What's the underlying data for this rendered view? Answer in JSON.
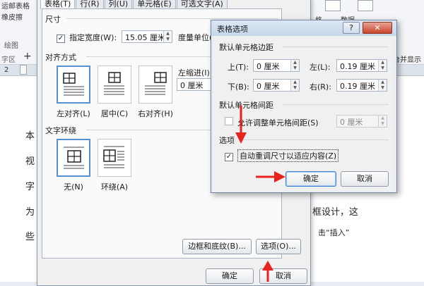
{
  "background": {
    "left_ribbon": [
      "运邮表格",
      "橡皮擦"
    ],
    "drawing_group": "绘图",
    "tab_zone": "字区",
    "plus": "+",
    "ruler_num": "2",
    "right_top": [
      "格",
      "数据"
    ],
    "merge_display": "台并显示",
    "doc_left_chars": [
      "本",
      "视",
      "字",
      "为",
      "些"
    ],
    "doc_right_line1": "框设计，这",
    "doc_right_line2": "击“插入”"
  },
  "table_props": {
    "tabs": [
      "表格(T)",
      "行(R)",
      "列(U)",
      "单元格(E)",
      "可选文字(A)"
    ],
    "size_section": "尺寸",
    "preferred_width_label": "指定宽度(W):",
    "preferred_width_checked": true,
    "preferred_width_value": "15.05 厘米",
    "measure_in_label": "度量单位(",
    "alignment_section": "对齐方式",
    "align_left": "左对齐(L)",
    "align_center": "居中(C)",
    "align_right": "右对齐(H)",
    "indent_label": "左缩进(I):",
    "indent_value": "0 厘米",
    "wrap_section": "文字环绕",
    "wrap_none": "无(N)",
    "wrap_around": "环绕(A)",
    "borders_button": "边框和底纹(B)...",
    "options_button": "选项(O)...",
    "ok_button": "确定",
    "cancel_button": "取消"
  },
  "table_options": {
    "title": "表格选项",
    "help": "?",
    "close": "✕",
    "margins_section": "默认单元格边距",
    "top_label": "上(T):",
    "top_value": "0 厘米",
    "left_label": "左(L):",
    "left_value": "0.19 厘米",
    "bottom_label": "下(B):",
    "bottom_value": "0 厘米",
    "right_label": "右(R):",
    "right_value": "0.19 厘米",
    "spacing_section": "默认单元格间距",
    "allow_spacing_label": "允许调整单元格间距(S)",
    "allow_spacing_checked": false,
    "spacing_value": "0 厘米",
    "options_section": "选项",
    "autoresize_label": "自动重调尺寸以适应内容(Z)",
    "autoresize_checked": true,
    "ok_button": "确定",
    "cancel_button": "取消"
  },
  "colors": {
    "annotation_arrow": "#e8231f",
    "selected_border": "#5b8fd6"
  }
}
